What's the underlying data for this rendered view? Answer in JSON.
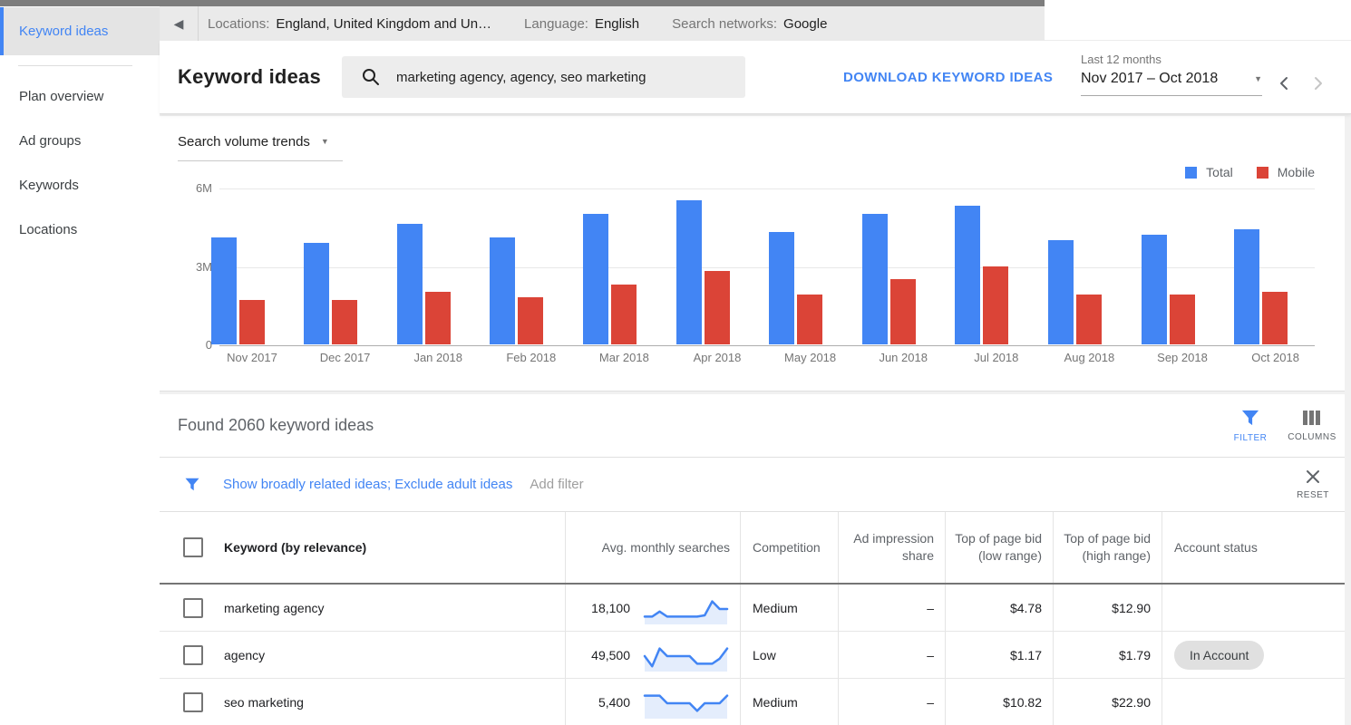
{
  "colors": {
    "blue": "#4285F4",
    "red": "#DB4437",
    "link": "#4285F4",
    "spark_fill": "#E4EDFC"
  },
  "sidebar": {
    "active_item": "Keyword ideas",
    "items": [
      "Plan overview",
      "Ad groups",
      "Keywords",
      "Locations"
    ]
  },
  "toolbar": {
    "groups": [
      {
        "label": "Locations:",
        "value": "England, United Kingdom and Un…"
      },
      {
        "label": "Language:",
        "value": "English"
      },
      {
        "label": "Search networks:",
        "value": "Google"
      }
    ]
  },
  "header": {
    "title": "Keyword ideas",
    "search_value": "marketing agency, agency, seo marketing",
    "download_label": "DOWNLOAD KEYWORD IDEAS",
    "range_caption": "Last 12 months",
    "range_value": "Nov 2017 – Oct 2018"
  },
  "chart_card": {
    "trends_label": "Search volume trends",
    "legend": [
      {
        "name": "Total",
        "color": "#4285F4"
      },
      {
        "name": "Mobile",
        "color": "#DB4437"
      }
    ]
  },
  "chart_data": {
    "type": "bar",
    "title": "Search volume trends",
    "categories": [
      "Nov 2017",
      "Dec 2017",
      "Jan 2018",
      "Feb 2018",
      "Mar 2018",
      "Apr 2018",
      "May 2018",
      "Jun 2018",
      "Jul 2018",
      "Aug 2018",
      "Sep 2018",
      "Oct 2018"
    ],
    "series": [
      {
        "name": "Total",
        "color": "#4285F4",
        "values": [
          4.1,
          3.9,
          4.6,
          4.1,
          5.0,
          5.5,
          4.3,
          5.0,
          5.3,
          4.0,
          4.2,
          4.4
        ]
      },
      {
        "name": "Mobile",
        "color": "#DB4437",
        "values": [
          1.7,
          1.7,
          2.0,
          1.8,
          2.3,
          2.8,
          1.9,
          2.5,
          3.0,
          1.9,
          1.9,
          2.0
        ]
      }
    ],
    "unit": "M",
    "ylim": [
      0,
      6
    ],
    "yticks": [
      "6M",
      "3M",
      "0"
    ],
    "xlabel": "",
    "ylabel": "",
    "grid": true,
    "legend_position": "top-right"
  },
  "results": {
    "found_text": "Found 2060 keyword ideas",
    "filter_label": "FILTER",
    "columns_label": "COLUMNS",
    "chips": "Show broadly related ideas; Exclude adult ideas",
    "add_filter": "Add filter",
    "reset_label": "RESET"
  },
  "table": {
    "headers": [
      "Keyword (by relevance)",
      "Avg. monthly searches",
      "Competition",
      "Ad impression share",
      "Top of page bid (low range)",
      "Top of page bid (high range)",
      "Account status"
    ],
    "rows": [
      {
        "keyword": "marketing agency",
        "avg_monthly_searches": "18,100",
        "trend": [
          2,
          2,
          4,
          2,
          2,
          2,
          2,
          2,
          2.5,
          8,
          5,
          5
        ],
        "competition": "Medium",
        "ad_impression_share": "–",
        "bid_low": "$4.78",
        "bid_high": "$12.90",
        "account_status": ""
      },
      {
        "keyword": "agency",
        "avg_monthly_searches": "49,500",
        "trend": [
          5,
          1,
          8,
          5,
          5,
          5,
          5,
          2,
          2,
          2,
          4,
          8
        ],
        "competition": "Low",
        "ad_impression_share": "–",
        "bid_low": "$1.17",
        "bid_high": "$1.79",
        "account_status": "In Account"
      },
      {
        "keyword": "seo marketing",
        "avg_monthly_searches": "5,400",
        "trend": [
          8,
          8,
          8,
          5,
          5,
          5,
          5,
          2,
          5,
          5,
          5,
          8
        ],
        "competition": "Medium",
        "ad_impression_share": "–",
        "bid_low": "$10.82",
        "bid_high": "$22.90",
        "account_status": ""
      }
    ]
  }
}
